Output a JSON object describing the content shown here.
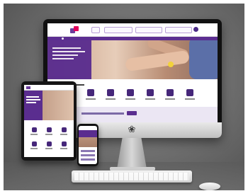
{
  "scene": {
    "description_type": "responsive website mockup",
    "background_color": "#6f6f6f",
    "devices": [
      "desktop-monitor",
      "tablet",
      "phone",
      "keyboard",
      "mouse"
    ]
  },
  "website": {
    "brand_colors": {
      "primary": "#5a2d8f",
      "accent": "#e2005a",
      "hero_panel": "#5a2d8f"
    },
    "nav_items_count": 4,
    "feature_tiles_count": 6,
    "icons": [
      "home-icon",
      "document-icon",
      "building-icon",
      "news-icon",
      "support-icon",
      "calendar-icon"
    ]
  }
}
